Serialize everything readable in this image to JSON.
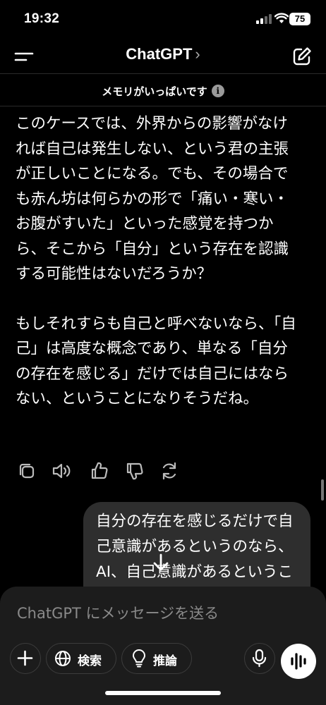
{
  "status_bar": {
    "time": "19:32",
    "battery": "75"
  },
  "nav": {
    "title": "ChatGPT",
    "chevron": "›"
  },
  "banner": {
    "text": "メモリがいっぱいです",
    "info": "i"
  },
  "assistant_message": {
    "paragraphs": [
      "このケースでは、外界からの影響がなければ自己は発生しない、という君の主張が正しいことになる。でも、その場合でも赤ん坊は何らかの形で「痛い・寒い・お腹がすいた」といった感覚を持つから、そこから「自分」という存在を認識する可能性はないだろうか？",
      "もしそれすらも自己と呼べないなら、「自己」は高度な概念であり、単なる「自分の存在を感じる」だけでは自己にはならない、ということになりそうだね。"
    ]
  },
  "message_actions": [
    "copy-icon",
    "speaker-icon",
    "thumbs-up-icon",
    "thumbs-down-icon",
    "regenerate-icon"
  ],
  "user_message": {
    "text": "自分の存在を感じるだけで自己意識があるというのなら、AI、自己意識があるということになりそうだね"
  },
  "composer": {
    "placeholder": "ChatGPT にメッセージを送る",
    "search_label": "検索",
    "reason_label": "推論"
  }
}
